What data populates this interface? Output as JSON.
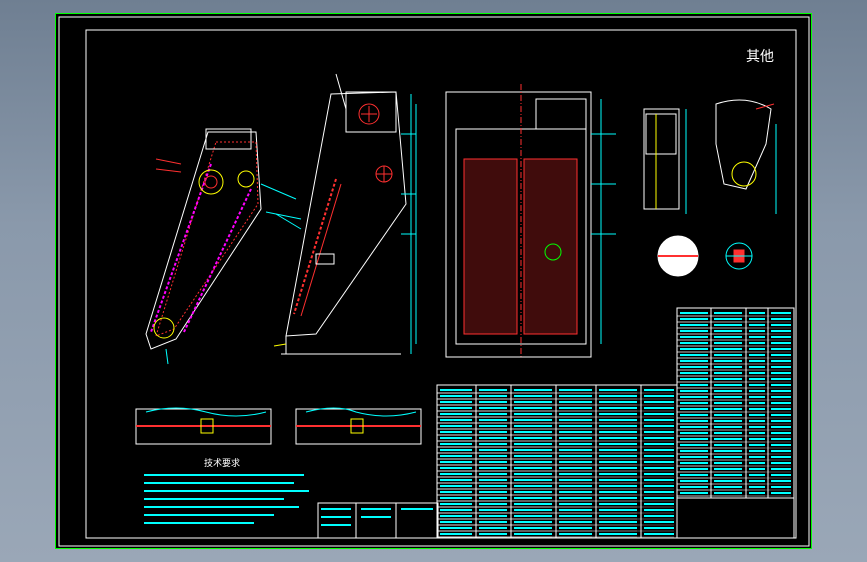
{
  "drawing": {
    "stamp_text": "其他",
    "tech_requirements_title": "技术要求"
  },
  "colors": {
    "background": "#000000",
    "frame": "#00ff00",
    "cyan": "#00ffff",
    "red": "#ff3030",
    "white": "#ffffff",
    "magenta": "#ff00ff",
    "yellow": "#ffff00",
    "window_bg": "#8a99ab"
  }
}
